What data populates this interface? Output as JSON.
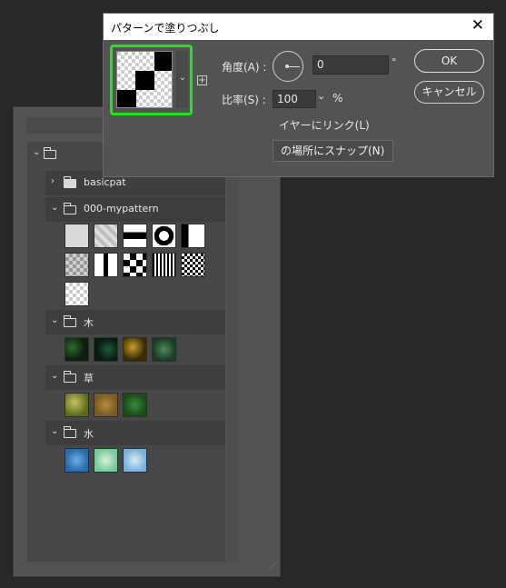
{
  "dialog": {
    "title": "パターンで塗りつぶし",
    "close_glyph": "✕",
    "angle_label": "角度(A) :",
    "angle_value": "0",
    "angle_unit": "°",
    "scale_label": "比率(S) :",
    "scale_value": "100",
    "scale_unit": "%",
    "link_label": "イヤーにリンク(L)",
    "snap_label": "の場所にスナップ(N)",
    "ok_label": "OK",
    "cancel_label": "キャンセル",
    "dropdown_glyph": "⌄",
    "new_preset_glyph": "+",
    "accent_color": "#1ee61e"
  },
  "panel": {
    "gear_glyph": "⚙▾",
    "root_chevron": "⌄",
    "groups": [
      {
        "name": "basicpat",
        "chevron": "›",
        "expanded": false,
        "folder_filled": true
      },
      {
        "name": "000-mypattern",
        "chevron": "⌄",
        "expanded": true,
        "folder_filled": false
      },
      {
        "name": "木",
        "chevron": "⌄",
        "expanded": true,
        "folder_filled": false
      },
      {
        "name": "草",
        "chevron": "⌄",
        "expanded": true,
        "folder_filled": false
      },
      {
        "name": "水",
        "chevron": "⌄",
        "expanded": true,
        "folder_filled": false
      }
    ],
    "resize_glyph": "⟋"
  }
}
